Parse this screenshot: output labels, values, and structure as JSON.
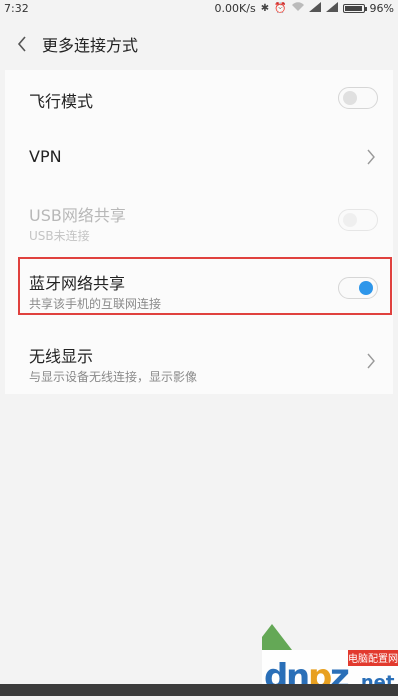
{
  "status_bar": {
    "time": "7:32",
    "speed": "0.00K/s",
    "battery_percent": "96%",
    "battery_level": 0.96
  },
  "header": {
    "title": "更多连接方式"
  },
  "items": [
    {
      "label": "飞行模式",
      "control": "toggle",
      "state": "off"
    },
    {
      "label": "VPN",
      "control": "chevron"
    },
    {
      "label": "USB网络共享",
      "sub": "USB未连接",
      "control": "toggle",
      "state": "disabled"
    },
    {
      "label": "蓝牙网络共享",
      "sub": "共享该手机的互联网连接",
      "control": "toggle",
      "state": "on",
      "highlighted": true
    },
    {
      "label": "无线显示",
      "sub": "与显示设备无线连接，显示影像",
      "control": "chevron"
    }
  ],
  "watermark": {
    "logo_text": "dnpz.net",
    "tag": "电脑配置网"
  },
  "colors": {
    "accent": "#2e96ea",
    "highlight": "#e0413e"
  }
}
